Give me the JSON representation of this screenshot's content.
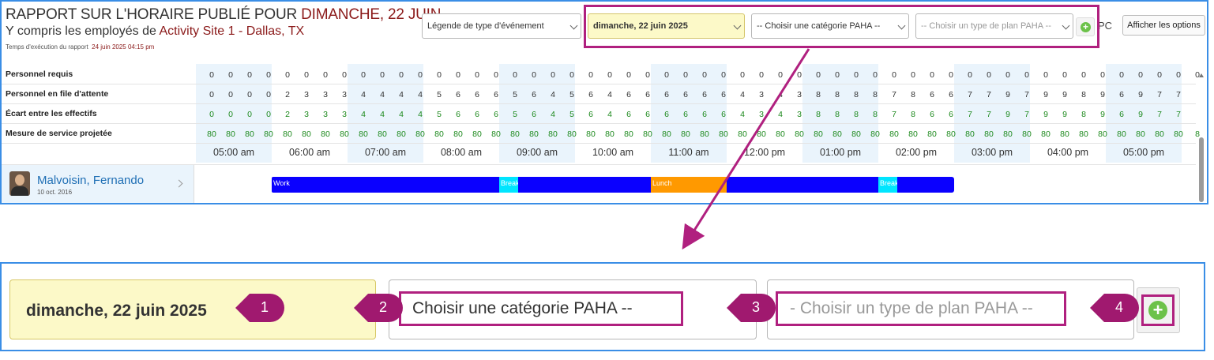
{
  "report": {
    "title_prefix": "RAPPORT SUR L'HORAIRE PUBLIÉ POUR ",
    "title_date": "DIMANCHE, 22 JUIN",
    "subtitle_prefix": "Y compris les employés de ",
    "subtitle_site": "Activity Site 1 - Dallas, TX",
    "run_time_label": "Temps d'exécution du rapport",
    "run_time_value": "24 juin 2025 04:15 pm"
  },
  "toolbar": {
    "event_legend": "Légende de type d'événement",
    "date": "dimanche, 22 juin 2025",
    "category": "-- Choisir une catégorie PAHA --",
    "plan_type": "-- Choisir un type de plan PAHA --",
    "pc_label": "PC",
    "options_button": "Afficher les options"
  },
  "metrics": {
    "rows": [
      {
        "label": "Personnel requis",
        "green": false,
        "values": [
          "0",
          "0",
          "0",
          "0",
          "0",
          "0",
          "0",
          "0",
          "0",
          "0",
          "0",
          "0",
          "0",
          "0",
          "0",
          "0",
          "0",
          "0",
          "0",
          "0",
          "0",
          "0",
          "0",
          "0",
          "0",
          "0",
          "0",
          "0",
          "0",
          "0",
          "0",
          "0",
          "0",
          "0",
          "0",
          "0",
          "0",
          "0",
          "0",
          "0",
          "0",
          "0",
          "0",
          "0",
          "0",
          "0",
          "0",
          "0",
          "0",
          "0",
          "0",
          "0",
          "0"
        ]
      },
      {
        "label": "Personnel en file d'attente",
        "green": false,
        "values": [
          "0",
          "0",
          "0",
          "0",
          "2",
          "3",
          "3",
          "3",
          "4",
          "4",
          "4",
          "4",
          "5",
          "6",
          "6",
          "6",
          "5",
          "6",
          "4",
          "5",
          "6",
          "4",
          "6",
          "6",
          "6",
          "6",
          "6",
          "6",
          "4",
          "3",
          "4",
          "3",
          "8",
          "8",
          "8",
          "8",
          "7",
          "8",
          "6",
          "6",
          "7",
          "7",
          "9",
          "7",
          "9",
          "9",
          "8",
          "9",
          "6",
          "9",
          "7",
          "7"
        ]
      },
      {
        "label": "Écart entre les effectifs",
        "green": true,
        "values": [
          "0",
          "0",
          "0",
          "0",
          "2",
          "3",
          "3",
          "3",
          "4",
          "4",
          "4",
          "4",
          "5",
          "6",
          "6",
          "6",
          "5",
          "6",
          "4",
          "5",
          "6",
          "4",
          "6",
          "6",
          "6",
          "6",
          "6",
          "6",
          "4",
          "3",
          "4",
          "3",
          "8",
          "8",
          "8",
          "8",
          "7",
          "8",
          "6",
          "6",
          "7",
          "7",
          "9",
          "7",
          "9",
          "9",
          "8",
          "9",
          "6",
          "9",
          "7",
          "7"
        ]
      },
      {
        "label": "Mesure de service projetée",
        "green": true,
        "values": [
          "80",
          "80",
          "80",
          "80",
          "80",
          "80",
          "80",
          "80",
          "80",
          "80",
          "80",
          "80",
          "80",
          "80",
          "80",
          "80",
          "80",
          "80",
          "80",
          "80",
          "80",
          "80",
          "80",
          "80",
          "80",
          "80",
          "80",
          "80",
          "80",
          "80",
          "80",
          "80",
          "80",
          "80",
          "80",
          "80",
          "80",
          "80",
          "80",
          "80",
          "80",
          "80",
          "80",
          "80",
          "80",
          "80",
          "80",
          "80",
          "80",
          "80",
          "80",
          "80",
          "8"
        ]
      }
    ]
  },
  "hours": [
    "05:00 am",
    "06:00 am",
    "07:00 am",
    "08:00 am",
    "09:00 am",
    "10:00 am",
    "11:00 am",
    "12:00 pm",
    "01:00 pm",
    "02:00 pm",
    "03:00 pm",
    "04:00 pm",
    "05:00 pm"
  ],
  "employee": {
    "name": "Malvoisin, Fernando",
    "date": "10 oct. 2016",
    "segments": [
      {
        "label": "Work",
        "color": "#0a00ff",
        "start": "06:00 am",
        "end": "09:00 am"
      },
      {
        "label": "Break",
        "color": "#00e5ff",
        "start": "09:00 am",
        "end": "09:15 am"
      },
      {
        "label": "",
        "color": "#0a00ff",
        "start": "09:15 am",
        "end": "11:00 am"
      },
      {
        "label": "Lunch",
        "color": "#ff9900",
        "start": "11:00 am",
        "end": "12:00 pm"
      },
      {
        "label": "",
        "color": "#0a00ff",
        "start": "12:00 pm",
        "end": "02:00 pm"
      },
      {
        "label": "Break",
        "color": "#00e5ff",
        "start": "02:00 pm",
        "end": "02:15 pm"
      },
      {
        "label": "",
        "color": "#0a00ff",
        "start": "02:15 pm",
        "end": "03:00 pm"
      }
    ]
  },
  "zoom": {
    "date": "dimanche, 22 juin 2025",
    "category": "Choisir une catégorie PAHA --",
    "plan_type": "- Choisir un type de plan PAHA --",
    "badges": [
      "1",
      "2",
      "3",
      "4"
    ]
  },
  "colors": {
    "accent_magenta": "#b0207f",
    "panel_border": "#3a8ee6",
    "highlight_yellow": "#fcf9c8",
    "add_green": "#6cc24a"
  }
}
